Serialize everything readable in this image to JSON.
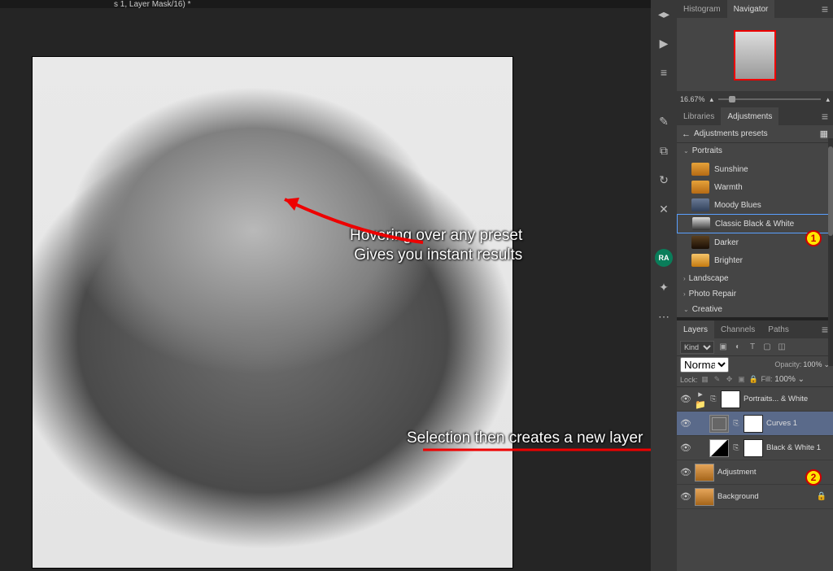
{
  "window": {
    "title_fragment": "s 1, Layer Mask/16) *"
  },
  "navigator": {
    "tabs": [
      "Histogram",
      "Navigator"
    ],
    "active_tab": "Navigator",
    "zoom": "16.67%"
  },
  "adjustments": {
    "tabs": [
      "Libraries",
      "Adjustments"
    ],
    "active_tab": "Adjustments",
    "header": "Adjustments presets",
    "groups": {
      "portraits": {
        "label": "Portraits",
        "expanded": true,
        "items": [
          "Sunshine",
          "Warmth",
          "Moody Blues",
          "Classic Black & White",
          "Darker",
          "Brighter"
        ]
      },
      "landscape": {
        "label": "Landscape",
        "expanded": false
      },
      "photo_repair": {
        "label": "Photo Repair",
        "expanded": false
      },
      "creative": {
        "label": "Creative",
        "expanded": true
      }
    },
    "selected_preset": "Classic Black & White"
  },
  "layers": {
    "tabs": [
      "Layers",
      "Channels",
      "Paths"
    ],
    "active_tab": "Layers",
    "kind_label": "Kind",
    "blend_mode": "Normal",
    "opacity_label": "Opacity:",
    "opacity_value": "100%",
    "lock_label": "Lock:",
    "fill_label": "Fill:",
    "fill_value": "100%",
    "entries": [
      {
        "name": "Portraits... & White",
        "type": "group"
      },
      {
        "name": "Curves 1",
        "type": "curves",
        "selected": true
      },
      {
        "name": "Black & White 1",
        "type": "bw"
      },
      {
        "name": "Adjustment",
        "type": "image"
      },
      {
        "name": "Background",
        "type": "image",
        "locked": true
      }
    ]
  },
  "annotations": {
    "line1": "Hovering over any preset",
    "line2": "Gives you instant results",
    "line3": "Selection then creates a new layer",
    "callout1": "1",
    "callout2": "2"
  },
  "vstrip_avatar": "RA"
}
